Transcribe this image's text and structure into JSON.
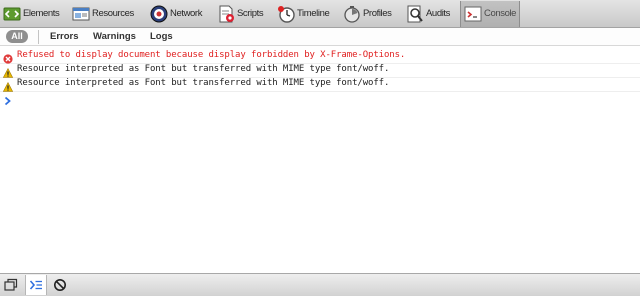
{
  "toolbar": {
    "tabs": [
      {
        "label": "Elements",
        "icon": "elements-icon"
      },
      {
        "label": "Resources",
        "icon": "resources-icon"
      },
      {
        "label": "Network",
        "icon": "network-icon"
      },
      {
        "label": "Scripts",
        "icon": "scripts-icon"
      },
      {
        "label": "Timeline",
        "icon": "timeline-icon"
      },
      {
        "label": "Profiles",
        "icon": "profiles-icon"
      },
      {
        "label": "Audits",
        "icon": "audits-icon"
      },
      {
        "label": "Console",
        "icon": "console-icon"
      }
    ],
    "active_tab": "Console"
  },
  "filters": {
    "all": "All",
    "errors": "Errors",
    "warnings": "Warnings",
    "logs": "Logs",
    "selected": "All"
  },
  "console": {
    "messages": [
      {
        "level": "error",
        "icon": "error-icon",
        "text": "Refused to display document because display forbidden by X-Frame-Options."
      },
      {
        "level": "warning",
        "icon": "warning-icon",
        "text": "Resource interpreted as Font but transferred with MIME type font/woff."
      },
      {
        "level": "warning",
        "icon": "warning-icon",
        "text": "Resource interpreted as Font but transferred with MIME type font/woff."
      }
    ],
    "prompt_icon": "prompt-chevron-icon"
  },
  "bottom_bar": {
    "buttons": [
      {
        "icon": "undock-icon"
      },
      {
        "icon": "console-drawer-icon"
      },
      {
        "icon": "clear-console-icon"
      }
    ]
  },
  "colors": {
    "error_text": "#e02020",
    "warning_icon": "#e8b800",
    "prompt": "#2f6fe0"
  }
}
